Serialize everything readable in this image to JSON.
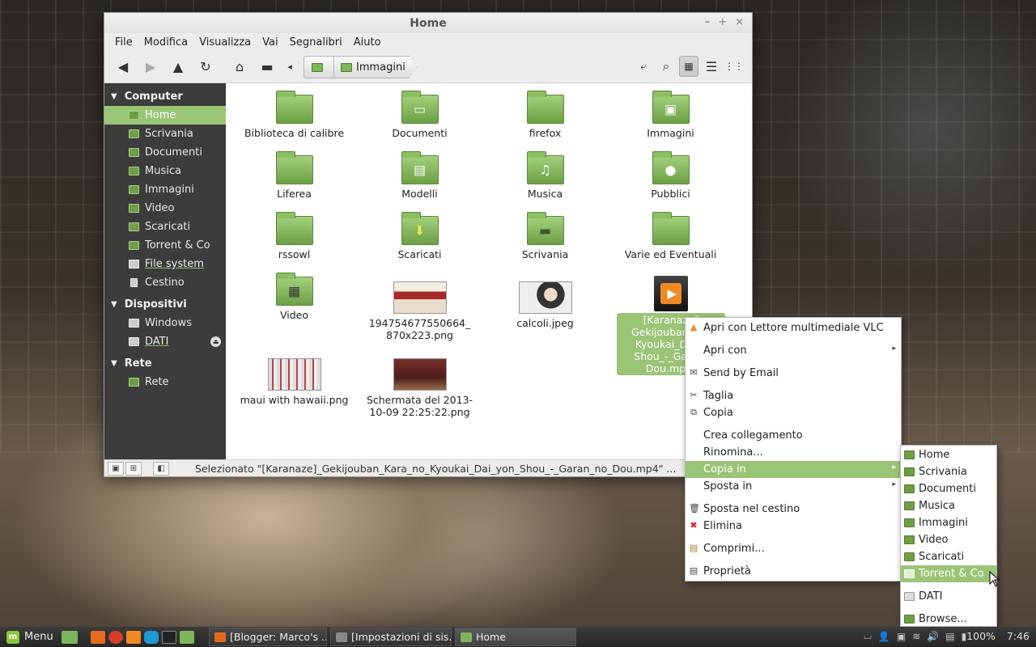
{
  "window": {
    "title": "Home",
    "controls": [
      "–",
      "+",
      "×"
    ]
  },
  "menubar": [
    "File",
    "Modifica",
    "Visualizza",
    "Vai",
    "Segnalibri",
    "Aiuto"
  ],
  "breadcrumb": {
    "current": "Immagini"
  },
  "sidebar": {
    "computer": {
      "heading": "Computer",
      "items": [
        "Home",
        "Scrivania",
        "Documenti",
        "Musica",
        "Immagini",
        "Video",
        "Scaricati",
        "Torrent & Co",
        "File system",
        "Cestino"
      ]
    },
    "devices": {
      "heading": "Dispositivi",
      "items": [
        "Windows",
        "DATI"
      ]
    },
    "network": {
      "heading": "Rete",
      "items": [
        "Rete"
      ]
    }
  },
  "files": [
    {
      "label": "Biblioteca di calibre",
      "kind": "folder",
      "glyph": ""
    },
    {
      "label": "Documenti",
      "kind": "folder",
      "glyph": "▭"
    },
    {
      "label": "firefox",
      "kind": "folder",
      "glyph": ""
    },
    {
      "label": "Immagini",
      "kind": "folder",
      "glyph": "▣"
    },
    {
      "label": "Liferea",
      "kind": "folder",
      "glyph": ""
    },
    {
      "label": "Modelli",
      "kind": "folder",
      "glyph": "▤"
    },
    {
      "label": "Musica",
      "kind": "folder",
      "glyph": "♫"
    },
    {
      "label": "Pubblici",
      "kind": "folder",
      "glyph": "●"
    },
    {
      "label": "rssowl",
      "kind": "folder",
      "glyph": ""
    },
    {
      "label": "Scaricati",
      "kind": "folder",
      "glyph": "⬇"
    },
    {
      "label": "Scrivania",
      "kind": "folder",
      "glyph": "▬"
    },
    {
      "label": "Varie ed Eventuali",
      "kind": "folder",
      "glyph": ""
    },
    {
      "label": "Video",
      "kind": "folder",
      "glyph": "▦"
    },
    {
      "label": "194754677550664_\n870x223.png",
      "kind": "image",
      "glyph": "opendata"
    },
    {
      "label": "calcoli.jpeg",
      "kind": "image",
      "glyph": "calcoli"
    },
    {
      "label": "[Karanaze]\nGekijouban_K...\nKyoukai_Dai...\nShou_-_Gara...\nDou.mp...",
      "kind": "video",
      "glyph": ""
    },
    {
      "label": "maui with hawaii.png",
      "kind": "image",
      "glyph": "maui"
    },
    {
      "label": "Schermata del 2013-\n10-09 22:25:22.png",
      "kind": "image",
      "glyph": "schermata"
    }
  ],
  "status": {
    "text": "Selezionato \"[Karanaze]_Gekijouban_Kara_no_Kyoukai_Dai_yon_Shou_-_Garan_no_Dou.mp4\" ..."
  },
  "context_menu": {
    "items": [
      {
        "label": "Apri con Lettore multimediale VLC",
        "icon": "vlc-icon"
      },
      {
        "label": "Apri con",
        "submenu": true
      },
      {
        "sep": true
      },
      {
        "label": "Send by Email",
        "icon": "email-icon"
      },
      {
        "sep": true
      },
      {
        "label": "Taglia",
        "icon": "scissors-icon"
      },
      {
        "label": "Copia",
        "icon": "copy-icon"
      },
      {
        "sep": true
      },
      {
        "label": "Crea collegamento"
      },
      {
        "label": "Rinomina..."
      },
      {
        "label": "Copia in",
        "submenu": true,
        "selected": true
      },
      {
        "label": "Sposta in",
        "submenu": true
      },
      {
        "sep": true
      },
      {
        "label": "Sposta nel cestino",
        "icon": "trash-icon"
      },
      {
        "label": "Elimina",
        "icon": "delete-icon"
      },
      {
        "sep": true
      },
      {
        "label": "Comprimi...",
        "icon": "archive-icon"
      },
      {
        "sep": true
      },
      {
        "label": "Proprietà",
        "icon": "properties-icon"
      }
    ]
  },
  "copy_submenu": {
    "items": [
      {
        "label": "Home"
      },
      {
        "label": "Scrivania"
      },
      {
        "label": "Documenti"
      },
      {
        "label": "Musica"
      },
      {
        "label": "Immagini"
      },
      {
        "label": "Video"
      },
      {
        "label": "Scaricati"
      },
      {
        "label": "Torrent & Co",
        "selected": true
      },
      {
        "sep": true
      },
      {
        "label": "DATI",
        "drive": true
      },
      {
        "sep": true
      },
      {
        "label": "Browse..."
      }
    ]
  },
  "panel": {
    "menu_label": "Menu",
    "tasks": [
      "[Blogger: Marco's ...",
      "[Impostazioni di sis...",
      "Home"
    ],
    "battery": "100%",
    "clock": "7:46"
  },
  "colors": {
    "accent": "#9bc576",
    "sidebar_bg": "#3c3c3c"
  }
}
